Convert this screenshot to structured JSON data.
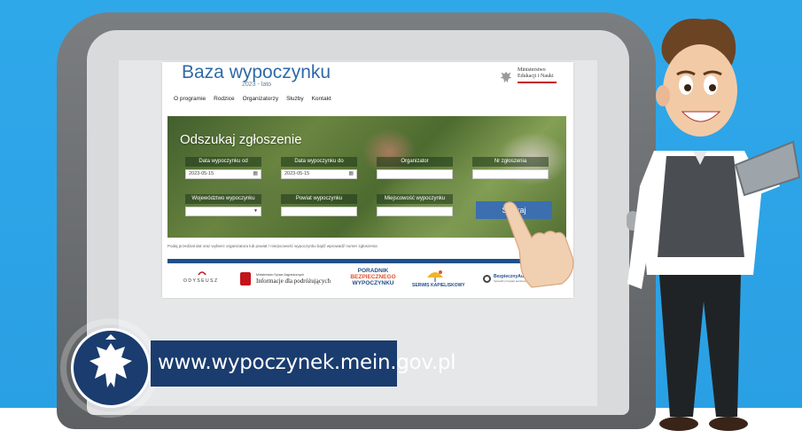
{
  "site": {
    "title": "Baza wypoczynku",
    "subtitle": "2023 - lato",
    "ministry_name": "Ministerstwo\nEdukacji i Nauki"
  },
  "nav": {
    "items": [
      {
        "label": "O programie"
      },
      {
        "label": "Rodzice"
      },
      {
        "label": "Organizatorzy"
      },
      {
        "label": "Służby"
      },
      {
        "label": "Kontakt"
      }
    ]
  },
  "search": {
    "heading": "Odszukaj zgłoszenie",
    "date_from_label": "Data wypoczynku od",
    "date_from_value": "2023-05-15",
    "date_to_label": "Data wypoczynku do",
    "date_to_value": "2023-05-15",
    "organizer_label": "Organizator",
    "organizer_value": "",
    "application_no_label": "Nr zgłoszenia",
    "application_no_value": "",
    "voivodeship_label": "Województwo wypoczynku",
    "voivodeship_value": "",
    "county_label": "Powiat wypoczynku",
    "county_value": "",
    "locality_label": "Miejscowość wypoczynku",
    "locality_value": "",
    "button_label": "Szukaj",
    "hint": "Podaj przedział dat oraz wybierz organizatora lub powiat / miejscowość wypoczynku bądź wprowadź numer zgłoszenia"
  },
  "partners": {
    "odyseusz": "ODYSEUSZ",
    "info_small": "Ministerstwo Spraw Zagranicznych",
    "info_text": "Informacje dla podróżujących",
    "poradnik_line1": "PORADNIK",
    "poradnik_line2": "BEZPIECZNEGO",
    "poradnik_line3": "WYPOCZYNKU",
    "serwis": "SERWIS KAPIELISKOWY",
    "bezpieczny": "BezpiecznyAutobus.gov.pl",
    "bezpieczny_sub": "Sprawdź przegląd autobusu przed wyjazdem"
  },
  "banner": {
    "url": "www.wypoczynek.mein.gov.pl"
  },
  "colors": {
    "background": "#2fa8ea",
    "brand_blue": "#1a3c6e",
    "site_title": "#2f6aa8",
    "search_button": "#3b6fb0",
    "ministry_red": "#c4131a"
  },
  "icons": {
    "calendar": "calendar-icon",
    "dropdown": "chevron-down-icon",
    "eagle": "polish-eagle-emblem",
    "pointer": "pointing-hand"
  }
}
